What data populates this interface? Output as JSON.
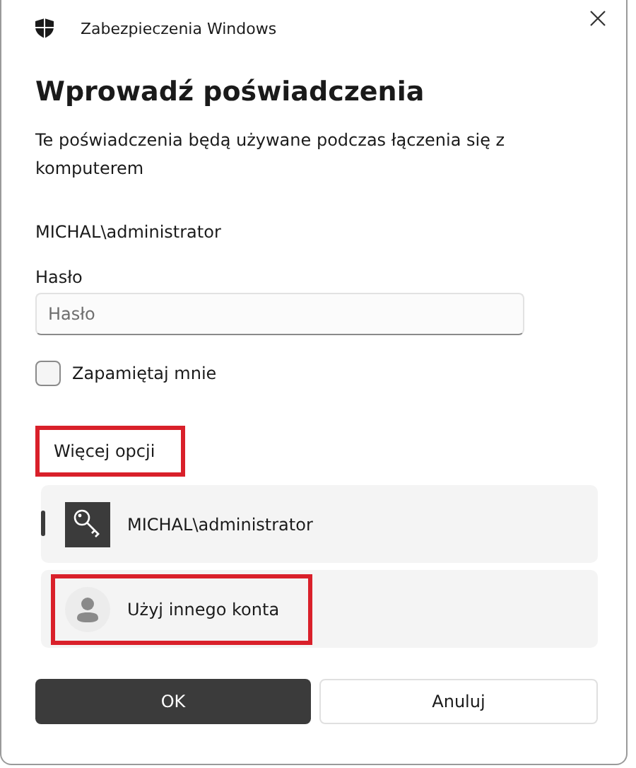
{
  "window": {
    "title": "Zabezpieczenia Windows"
  },
  "heading": "Wprowadź poświadczenia",
  "description": "Te poświadczenia będą używane podczas łączenia się z komputerem",
  "username": "MICHAL\\administrator",
  "password": {
    "label": "Hasło",
    "placeholder": "Hasło"
  },
  "remember": {
    "label": "Zapamiętaj mnie",
    "checked": false
  },
  "more_options": {
    "label": "Więcej opcji",
    "highlighted": true
  },
  "accounts": [
    {
      "kind": "key",
      "label": "MICHAL\\administrator",
      "selected": true,
      "highlighted": false
    },
    {
      "kind": "person",
      "label": "Użyj innego konta",
      "selected": false,
      "highlighted": true
    }
  ],
  "buttons": [
    {
      "label": "OK",
      "kind": "primary"
    },
    {
      "label": "Anuluj",
      "kind": "secondary"
    }
  ]
}
